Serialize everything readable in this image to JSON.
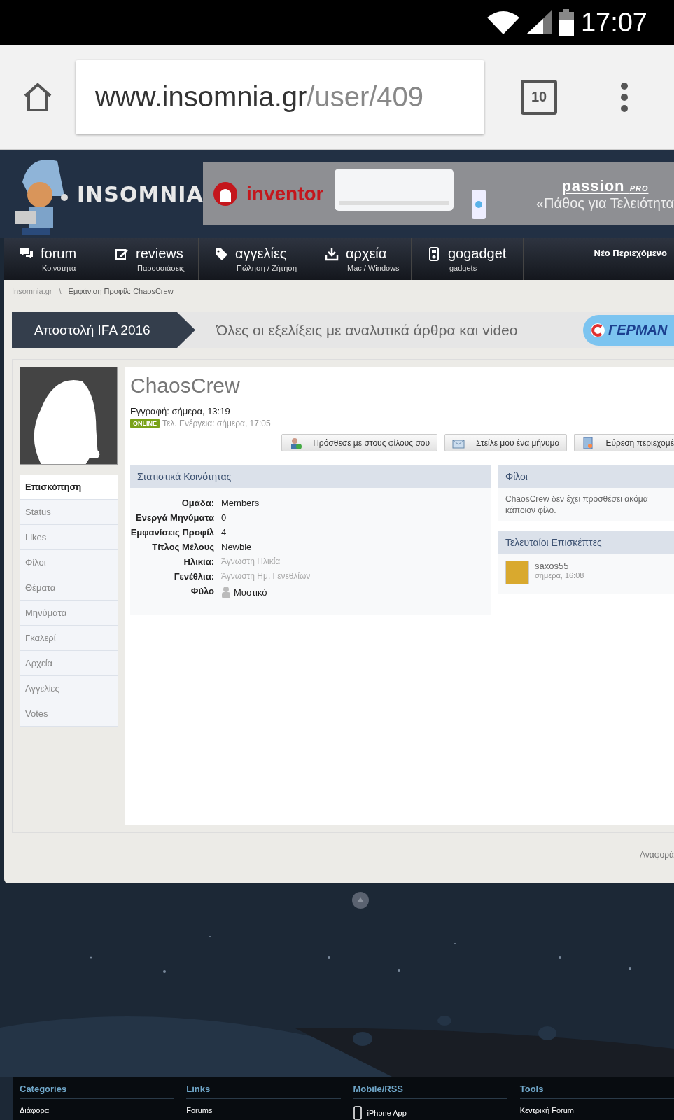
{
  "status_bar": {
    "time": "17:07"
  },
  "browser": {
    "url_host": "www.insomnia.gr",
    "url_path": "/user/409",
    "tab_count": "10"
  },
  "header": {
    "logo": "INSOMNIA",
    "ad": {
      "brand": "inventor",
      "brand2": "passion",
      "brand2_sub": "PRO",
      "slogan": "«Πάθος για Τελειότητα"
    }
  },
  "nav": {
    "items": [
      {
        "label": "forum",
        "sub": "Κοινότητα",
        "kind": "chat"
      },
      {
        "label": "reviews",
        "sub": "Παρουσιάσεις",
        "kind": "edit"
      },
      {
        "label": "αγγελίες",
        "sub": "Πώληση / Ζήτηση",
        "kind": "tag"
      },
      {
        "label": "αρχεία",
        "sub": "Mac / Windows",
        "kind": "download"
      },
      {
        "label": "gogadget",
        "sub": "gadgets",
        "kind": "device"
      }
    ],
    "right": "Νέο Περιεχόμενο"
  },
  "breadcrumb": {
    "items": [
      "Insomnia.gr",
      "Εμφάνιση Προφίλ: ChaosCrew"
    ],
    "separator": "\\"
  },
  "banner": {
    "title": "Αποστολή IFA 2016",
    "text": "Όλες οι εξελίξεις με αναλυτικά άρθρα και video",
    "logo": "ΓΕΡΜΑΝ"
  },
  "profile": {
    "username": "ChaosCrew",
    "joined": "Εγγραφή: σήμερα, 13:19",
    "online": true,
    "online_badge": "ONLINE",
    "last_activity": "Τελ. Ενέργεια: σήμερα, 17:05",
    "actions": [
      {
        "label": "Πρόσθεσε με στους φίλους σου",
        "kind": "friend"
      },
      {
        "label": "Στείλε μου ένα μήνυμα",
        "kind": "message"
      },
      {
        "label": "Εύρεση περιεχομέ",
        "kind": "search"
      }
    ]
  },
  "tabs": [
    {
      "label": "Επισκόπηση",
      "selected": true
    },
    {
      "label": "Status",
      "selected": false
    },
    {
      "label": "Likes",
      "selected": false
    },
    {
      "label": "Φίλοι",
      "selected": false
    },
    {
      "label": "Θέματα",
      "selected": false
    },
    {
      "label": "Μηνύματα",
      "selected": false
    },
    {
      "label": "Γκαλερί",
      "selected": false
    },
    {
      "label": "Αρχεία",
      "selected": false
    },
    {
      "label": "Αγγελίες",
      "selected": false
    },
    {
      "label": "Votes",
      "selected": false
    }
  ],
  "stats": {
    "title": "Στατιστικά Κοινότητας",
    "rows": [
      {
        "label": "Ομάδα:",
        "value": "Members",
        "kind": "text"
      },
      {
        "label": "Ενεργά Μηνύματα",
        "value": "0",
        "kind": "text"
      },
      {
        "label": "Εμφανίσεις Προφίλ",
        "value": "4",
        "kind": "text"
      },
      {
        "label": "Τίτλος Μέλους",
        "value": "Newbie",
        "kind": "text"
      },
      {
        "label": "Ηλικία:",
        "value": "Άγνωστη Ηλικία",
        "kind": "muted"
      },
      {
        "label": "Γενέθλια:",
        "value": "Άγνωστη Ημ. Γενεθλίων",
        "kind": "muted"
      },
      {
        "label": "Φύλο",
        "value": "Μυστικό",
        "kind": "gender"
      }
    ]
  },
  "friends": {
    "title": "Φίλοι",
    "text": "ChaosCrew δεν έχει προσθέσει ακόμα κάποιον φίλο."
  },
  "visitors": {
    "title": "Τελευταίοι Επισκέπτες",
    "items": [
      {
        "name": "saxos55",
        "time": "σήμερα, 16:08"
      }
    ]
  },
  "report": "Αναφορά",
  "footer": {
    "columns": [
      {
        "title": "Categories",
        "items": [
          {
            "label": "Διάφορα",
            "kind": "text"
          }
        ]
      },
      {
        "title": "Links",
        "items": [
          {
            "label": "Forums",
            "kind": "text"
          }
        ]
      },
      {
        "title": "Mobile/RSS",
        "items": [
          {
            "label": "iPhone App",
            "kind": "phone"
          }
        ]
      },
      {
        "title": "Tools",
        "items": [
          {
            "label": "Κεντρική Forum",
            "kind": "text"
          }
        ]
      }
    ]
  }
}
